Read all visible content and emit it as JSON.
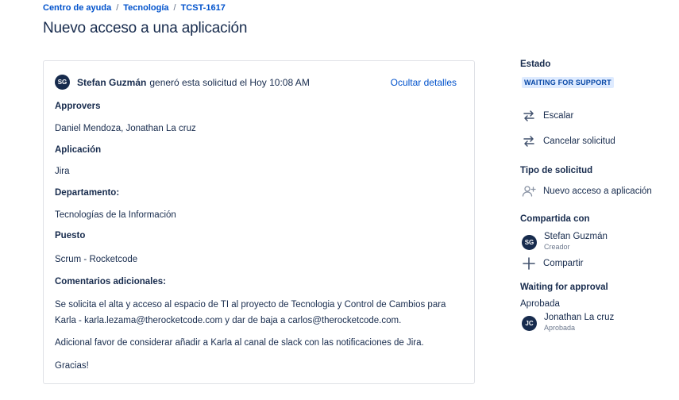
{
  "breadcrumb": {
    "items": [
      "Centro de ayuda",
      "Tecnología",
      "TCST-1617"
    ],
    "separator": "/"
  },
  "page": {
    "title": "Nuevo acceso a una aplicación"
  },
  "request": {
    "author_initials": "SG",
    "author": "Stefan Guzmán",
    "action": "generó esta solicitud el Hoy 10:08 AM",
    "hide_details": "Ocultar detalles",
    "fields": {
      "approvers_label": "Approvers",
      "approvers_value": "Daniel Mendoza, Jonathan La cruz",
      "app_label": "Aplicación",
      "app_value": "Jira",
      "dept_label": "Departamento:",
      "dept_value": "Tecnologías de la Información",
      "role_label": "Puesto",
      "role_value": "Scrum - Rocketcode",
      "comments_label": "Comentarios adicionales:",
      "comments_line1": "Se solicita el alta y acceso al espacio de TI al proyecto de Tecnologia y Control de Cambios para",
      "comments_line2": "Karla - karla.lezama@therocketcode.com y dar de baja a carlos@therocketcode.com.",
      "comments_line3": "Adicional favor de considerar añadir a Karla al canal de slack con las notificaciones de Jira.",
      "comments_line4": "Gracias!"
    }
  },
  "sidebar": {
    "status_label": "Estado",
    "status_value": "WAITING FOR SUPPORT",
    "escalate": "Escalar",
    "cancel": "Cancelar solicitud",
    "type_label": "Tipo de solicitud",
    "type_value": "Nuevo acceso a aplicación",
    "shared_label": "Compartida con",
    "shared_initials": "SG",
    "shared_name": "Stefan Guzmán",
    "shared_role": "Creador",
    "share_button": "Compartir",
    "approval_label": "Waiting for approval",
    "approved_label": "Aprobada",
    "approver_initials": "JC",
    "approver_name": "Jonathan La cruz",
    "approver_role": "Aprobada"
  },
  "colors": {
    "link": "#0052cc",
    "text": "#172b4d",
    "badge_bg": "#deebff",
    "badge_text": "#0747a6",
    "avatar_bg": "#172b4d"
  }
}
